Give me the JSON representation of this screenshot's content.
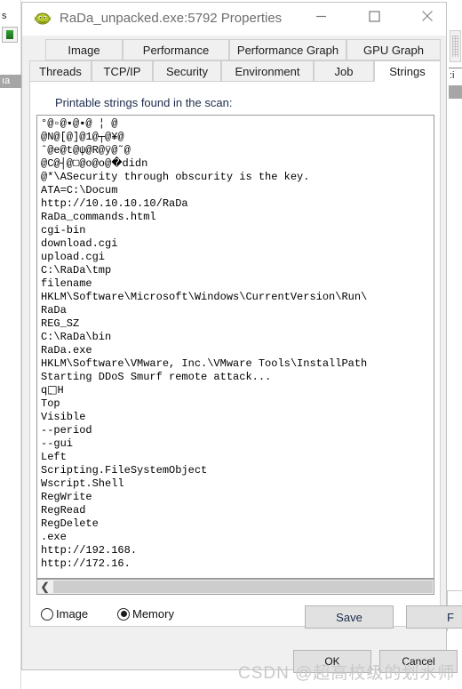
{
  "window": {
    "title": "RaDa_unpacked.exe:5792 Properties",
    "icon": "pufferfish-icon",
    "controls": {
      "minimize": "minimize-icon",
      "maximize": "maximize-icon",
      "close": "close-icon"
    }
  },
  "tabs": {
    "row1": [
      {
        "label": "Image",
        "active": false
      },
      {
        "label": "Performance",
        "active": false
      },
      {
        "label": "Performance Graph",
        "active": false
      },
      {
        "label": "GPU Graph",
        "active": false
      }
    ],
    "row2": [
      {
        "label": "Threads",
        "active": false
      },
      {
        "label": "TCP/IP",
        "active": false
      },
      {
        "label": "Security",
        "active": false
      },
      {
        "label": "Environment",
        "active": false
      },
      {
        "label": "Job",
        "active": false
      },
      {
        "label": "Strings",
        "active": true
      }
    ]
  },
  "page": {
    "label": "Printable strings found in the scan:",
    "strings": [
      "°@▫@▪@▪@ ¦ @",
      "@N@[@]@1@┬@¥@",
      "ˆ@e@t@ψ@R@ÿ@˜@",
      "@C@┤@□@о@о@�didn",
      "@*\\ASecurity through obscurity is the key.",
      "ATA=C:\\Docum",
      "http://10.10.10.10/RaDa",
      "RaDa_commands.html",
      "cgi-bin",
      "download.cgi",
      "upload.cgi",
      "C:\\RaDa\\tmp",
      "filename",
      "HKLM\\Software\\Microsoft\\Windows\\CurrentVersion\\Run\\",
      "RaDa",
      "REG_SZ",
      "C:\\RaDa\\bin",
      "RaDa.exe",
      "HKLM\\Software\\VMware, Inc.\\VMware Tools\\InstallPath",
      "Starting DDoS Smurf remote attack...",
      "q□ِH",
      "Top",
      "Visible",
      "--period",
      "--gui",
      "Left",
      "Scripting.FileSystemObject",
      "Wscript.Shell",
      "RegWrite",
      "RegRead",
      "RegDelete",
      ".exe",
      "http://192.168.",
      "http://172.16."
    ],
    "hscroll": {
      "left_arrow": "chevron-left-icon"
    },
    "source": {
      "image_label": "Image",
      "image_selected": false,
      "memory_label": "Memory",
      "memory_selected": true
    },
    "save_label": "Save",
    "find_label": "F"
  },
  "footer": {
    "ok_label": "OK",
    "cancel_label": "Cancel"
  },
  "watermark": "CSDN @超高校级的划水师",
  "backdrop": {
    "left_texts": [
      "s",
      "ıa"
    ],
    "right_texts": [
      ":i"
    ],
    "percent": "%"
  },
  "colors": {
    "dialog_bg": "#f0f0f0",
    "page_bg": "#ffffff",
    "tab_border": "#d0d0d0",
    "title_text": "#6e6e6e",
    "label_text": "#1b2b4b",
    "scroll_thumb": "#cdcdcd",
    "button_face": "#e1e1e1"
  }
}
